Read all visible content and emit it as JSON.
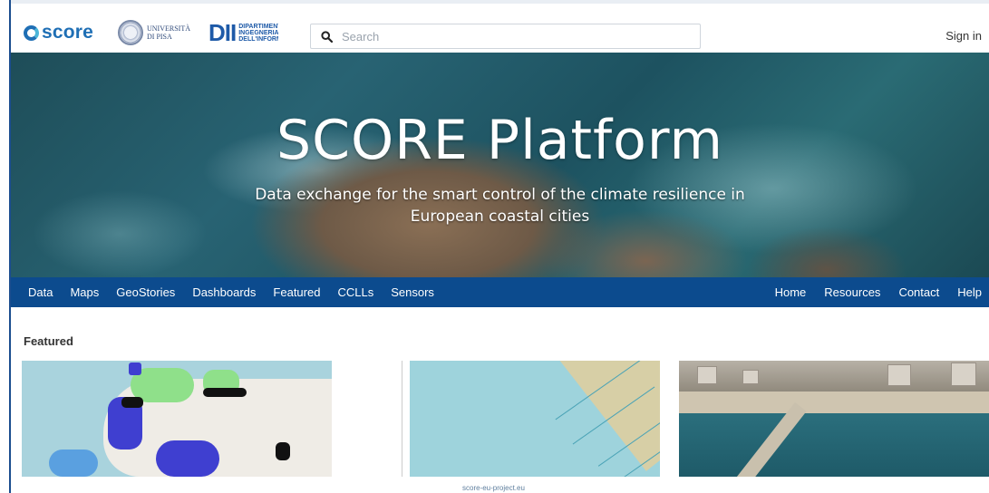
{
  "header": {
    "logo_text": "score",
    "unipi_line1": "UNIVERSITÀ",
    "unipi_line2": "DI PISA",
    "dii_mark": "DII",
    "dii_text": "DIPARTIMENTO INGEGNERIA DELL'INFORMAZ",
    "search_placeholder": "Search",
    "signin_label": "Sign in"
  },
  "hero": {
    "title": "SCORE Platform",
    "subtitle_line1": "Data exchange for the smart control of the climate resilience in",
    "subtitle_line2": "European coastal cities"
  },
  "nav": {
    "left": [
      "Data",
      "Maps",
      "GeoStories",
      "Dashboards",
      "Featured",
      "CCLLs",
      "Sensors"
    ],
    "right": [
      "Home",
      "Resources",
      "Contact",
      "Help"
    ]
  },
  "featured": {
    "title": "Featured",
    "caption": "score-eu-project.eu"
  },
  "colors": {
    "brand_blue": "#0c4b8e",
    "logo_blue": "#1f6fb5"
  }
}
